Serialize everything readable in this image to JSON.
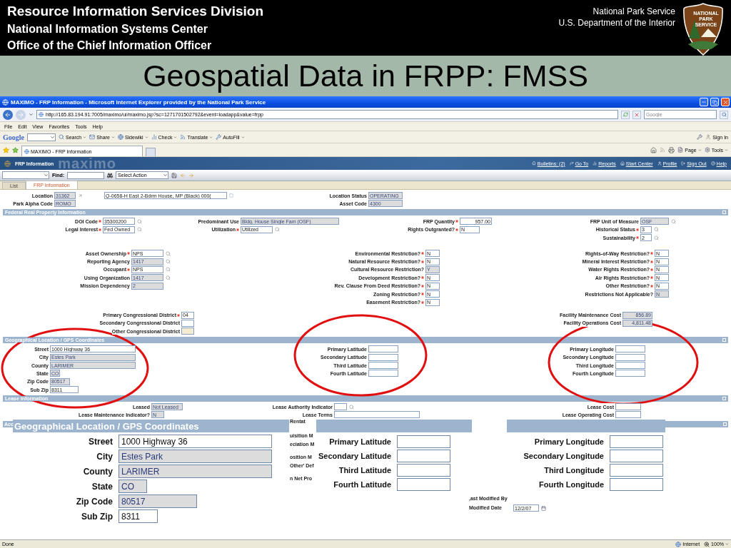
{
  "slide": {
    "header_lines": [
      "Resource Information Services Division",
      "National Information Systems Center",
      "Office of the Chief Information Officer"
    ],
    "org_lines": [
      "National Park Service",
      "U.S. Department of the Interior"
    ],
    "logo_lines": [
      "NATIONAL",
      "PARK",
      "SERVICE"
    ],
    "title": "Geospatial Data in FRPP: FMSS"
  },
  "browser": {
    "title": "MAXIMO - FRP Information - Microsoft Internet Explorer provided by the National Park Service",
    "url": "http://165.83.194.91:7005/maximo/ui/maximo.jsp?sc=1271701502792&event=loadapp&value=frpp",
    "search_placeholder": "Google",
    "menu": [
      "File",
      "Edit",
      "View",
      "Favorites",
      "Tools",
      "Help"
    ],
    "google_label": "Google",
    "google_buttons": [
      "Search",
      "Share",
      "Sidewiki",
      "Check",
      "Translate",
      "AutoFill"
    ],
    "sign_in": "Sign In",
    "tab": "MAXIMO - FRP Information",
    "commands": [
      "Page",
      "Tools"
    ],
    "status": "Done",
    "zone": "Internet",
    "zoom": "100%"
  },
  "app": {
    "title": "FRP Information",
    "brand": "maximo",
    "links": [
      "Bulletins: (2)",
      "Go To",
      "Reports",
      "Start Center",
      "Profile",
      "Sign Out",
      "Help"
    ],
    "find_label": "Find:",
    "action_placeholder": "Select Action",
    "tabs": [
      {
        "label": "List",
        "selected": false
      },
      {
        "label": "FRP Information",
        "selected": true
      }
    ]
  },
  "record": [
    {
      "column_1": [
        {
          "label": "Location",
          "value": "31362",
          "kind": "readonly",
          "required": false,
          "lookup": false
        },
        {
          "label": "Park Alpha Code",
          "value": "ROMO",
          "kind": "readonly",
          "required": false,
          "lookup": false
        }
      ],
      "column_2": [
        {
          "value": "Q-0658-H East 2-Bdrm House, MP (Black) 000(",
          "kind": "editable",
          "required": false,
          "lookup": false
        }
      ],
      "column_3": [
        {
          "label": "Location Status",
          "value": "OPERATING",
          "kind": "readonly",
          "required": false,
          "lookup": false
        },
        {
          "label": "Asset Code",
          "value": "4300",
          "kind": "readonly",
          "required": false,
          "lookup": false
        }
      ]
    }
  ],
  "sections": [
    {
      "title": "Federal Real Property Information",
      "blocks": [
        {
          "column_1": [
            {
              "label": "DOI Code",
              "value": "35300200",
              "kind": "editable",
              "required": true,
              "lookup": true
            },
            {
              "label": "Legal Interest",
              "value": "Fed Owned",
              "kind": "editable",
              "required": true,
              "lookup": true
            }
          ],
          "column_2": [
            {
              "label": "Predominant Use",
              "value": "Bldg. House Single Fam (OSF)",
              "kind": "readonly",
              "required": false,
              "lookup": false
            },
            {
              "label": "Utilization",
              "value": "Utilized",
              "kind": "editable",
              "required": true,
              "lookup": true
            }
          ],
          "column_3": [
            {
              "label": "FRP Quantity",
              "value": "957.00",
              "kind": "editable",
              "required": true,
              "lookup": false,
              "numeric": true
            },
            {
              "label": "Rights Outgranted?",
              "value": "N",
              "kind": "editable",
              "required": true,
              "lookup": false
            }
          ],
          "column_4": [
            {
              "label": "FRP Unit of Measure",
              "value": "OSF",
              "kind": "readonly",
              "required": false,
              "lookup": true
            },
            {
              "label": "Historical Status",
              "value": "3",
              "kind": "editable",
              "required": true,
              "lookup": true
            },
            {
              "label": "Sustainability",
              "value": "2",
              "kind": "editable",
              "required": true,
              "lookup": true
            }
          ]
        },
        {
          "column_1": [
            {
              "label": "Asset Ownership",
              "value": "NPS",
              "kind": "editable",
              "required": true,
              "lookup": true
            },
            {
              "label": "Reporting Agency",
              "value": "1417",
              "kind": "readonly",
              "required": false,
              "lookup": true
            },
            {
              "label": "Occupant",
              "value": "NPS",
              "kind": "editable",
              "required": true,
              "lookup": true
            },
            {
              "label": "Using Organization",
              "value": "1417",
              "kind": "readonly",
              "required": false,
              "lookup": true
            },
            {
              "label": "Mission Dependency",
              "value": "2",
              "kind": "readonly",
              "required": false,
              "lookup": false
            }
          ],
          "column_3": [
            {
              "label": "Environmental Restriction?",
              "value": "N",
              "kind": "editable",
              "required": true,
              "lookup": false
            },
            {
              "label": "Natural Resource Restriction?",
              "value": "N",
              "kind": "editable",
              "required": true,
              "lookup": false
            },
            {
              "label": "Cultural Resource Restriction?",
              "value": "Y",
              "kind": "readonly",
              "required": false,
              "lookup": false
            },
            {
              "label": "Development Restriction?",
              "value": "N",
              "kind": "editable",
              "required": true,
              "lookup": false
            },
            {
              "label": "Rev. Clause From Deed Restriction?",
              "value": "N",
              "kind": "editable",
              "required": true,
              "lookup": false
            },
            {
              "label": "Zoning Restriction?",
              "value": "N",
              "kind": "editable",
              "required": true,
              "lookup": false
            },
            {
              "label": "Easement Restriction?",
              "value": "N",
              "kind": "editable",
              "required": true,
              "lookup": false
            }
          ],
          "column_4": [
            {
              "label": "Rights-of-Way Restriction?",
              "value": "N",
              "kind": "editable",
              "required": true,
              "lookup": false
            },
            {
              "label": "Mineral Interest Restriction?",
              "value": "N",
              "kind": "editable",
              "required": true,
              "lookup": false
            },
            {
              "label": "Water Rights Restriction?",
              "value": "N",
              "kind": "editable",
              "required": true,
              "lookup": false
            },
            {
              "label": "Air Rights Restriction?",
              "value": "N",
              "kind": "editable",
              "required": true,
              "lookup": false
            },
            {
              "label": "Other Restriction?",
              "value": "N",
              "kind": "editable",
              "required": true,
              "lookup": false
            },
            {
              "label": "Restrictions Not Applicable?",
              "value": "N",
              "kind": "readonly",
              "required": false,
              "lookup": false
            }
          ]
        },
        {
          "column_1": [
            {
              "label": "Primary Congressional District",
              "value": "04",
              "kind": "editable",
              "required": true,
              "lookup": false
            },
            {
              "label": "Secondary Congressional District",
              "kind": "editable",
              "required": false,
              "lookup": false
            },
            {
              "label": "Other Congressional District",
              "kind": "highlight",
              "required": false,
              "lookup": false
            }
          ],
          "column_4": [
            {
              "label": "Facility Maintenance Cost",
              "value": "856.89",
              "kind": "readonly",
              "required": false,
              "lookup": false,
              "numeric": true
            },
            {
              "label": "Facility Operations Cost",
              "value": "4,811.48",
              "kind": "readonly",
              "required": false,
              "lookup": false,
              "numeric": true
            }
          ]
        }
      ]
    },
    {
      "title": "Geographical Location / GPS Coordinates",
      "blocks": [
        {
          "column_1": [
            {
              "label": "Street",
              "value": "1000 Highway 36",
              "kind": "editable",
              "required": false,
              "lookup": false
            },
            {
              "label": "City",
              "value": "Estes Park",
              "kind": "readonly",
              "required": false,
              "lookup": false
            },
            {
              "label": "County",
              "value": "LARIMER",
              "kind": "readonly",
              "required": false,
              "lookup": false
            },
            {
              "label": "State",
              "value": "CO",
              "kind": "readonly",
              "required": false,
              "lookup": false
            },
            {
              "label": "Zip Code",
              "value": "80517",
              "kind": "readonly",
              "required": false,
              "lookup": false
            },
            {
              "label": "Sub Zip",
              "value": "8311",
              "kind": "editable",
              "required": false,
              "lookup": false
            }
          ],
          "column_3": [
            {
              "label": "Primary Latitude",
              "kind": "editable",
              "required": false,
              "lookup": false
            },
            {
              "label": "Secondary Latitude",
              "kind": "editable",
              "required": false,
              "lookup": false
            },
            {
              "label": "Third Latitude",
              "kind": "editable",
              "required": false,
              "lookup": false
            },
            {
              "label": "Fourth Latitude",
              "kind": "editable",
              "required": false,
              "lookup": false
            }
          ],
          "column_4": [
            {
              "label": "Primary Longitude",
              "kind": "editable",
              "required": false,
              "lookup": false
            },
            {
              "label": "Secondary Longitude",
              "kind": "editable",
              "required": false,
              "lookup": false
            },
            {
              "label": "Third Longitude",
              "kind": "editable",
              "required": false,
              "lookup": false
            },
            {
              "label": "Fourth Longitude",
              "kind": "editable",
              "required": false,
              "lookup": false
            }
          ]
        }
      ]
    },
    {
      "title": "Lease Information",
      "blocks": [
        {
          "column_1": [
            {
              "label": "Leased",
              "value": "Not Leased",
              "kind": "readonly",
              "required": false,
              "lookup": false
            },
            {
              "label": "Lease Maintenance Indicator?",
              "value": "N",
              "kind": "readonly",
              "required": false,
              "lookup": false
            }
          ],
          "column_2": [
            {
              "label": "Lease Authority Indicator",
              "kind": "editable",
              "required": false,
              "lookup": true
            },
            {
              "label": "Lease Terms",
              "kind": "editable",
              "required": false,
              "lookup": false
            }
          ],
          "column_4": [
            {
              "label": "Lease Cost",
              "kind": "editable",
              "required": false,
              "lookup": false
            },
            {
              "label": "Lease Operating Cost",
              "kind": "editable",
              "required": false,
              "lookup": false
            }
          ]
        }
      ]
    }
  ],
  "covered": {
    "section_title": "Acc",
    "label_fragments": [
      "Rentat",
      "uisition M",
      "eciation M",
      "osition M",
      "Other' Def",
      "n Net Pro"
    ],
    "modified_by_label": ",ast Modified By",
    "modified_date_label": "Modified Date",
    "modified_date": "12/2/07"
  },
  "insets": [
    {
      "title": "Geographical Location / GPS Coordinates",
      "fields": [
        {
          "label": "Street",
          "value": "1000 Highway 36",
          "kind": "editable"
        },
        {
          "label": "City",
          "value": "Estes Park",
          "kind": "readonly"
        },
        {
          "label": "County",
          "value": "LARIMER",
          "kind": "readonly"
        },
        {
          "label": "State",
          "value": "CO",
          "kind": "readonly"
        },
        {
          "label": "Zip Code",
          "value": "80517",
          "kind": "readonly"
        },
        {
          "label": "Sub Zip",
          "value": "8311",
          "kind": "editable"
        }
      ]
    },
    {
      "fields": [
        {
          "label": "Primary Latitude",
          "kind": "editable"
        },
        {
          "label": "Secondary Latitude",
          "kind": "editable"
        },
        {
          "label": "Third Latitude",
          "kind": "editable"
        },
        {
          "label": "Fourth Latitude",
          "kind": "editable"
        }
      ]
    },
    {
      "fields": [
        {
          "label": "Primary Longitude",
          "kind": "editable"
        },
        {
          "label": "Secondary Longitude",
          "kind": "editable"
        },
        {
          "label": "Third Longitude",
          "kind": "editable"
        },
        {
          "label": "Fourth Longitude",
          "kind": "editable"
        }
      ]
    }
  ]
}
